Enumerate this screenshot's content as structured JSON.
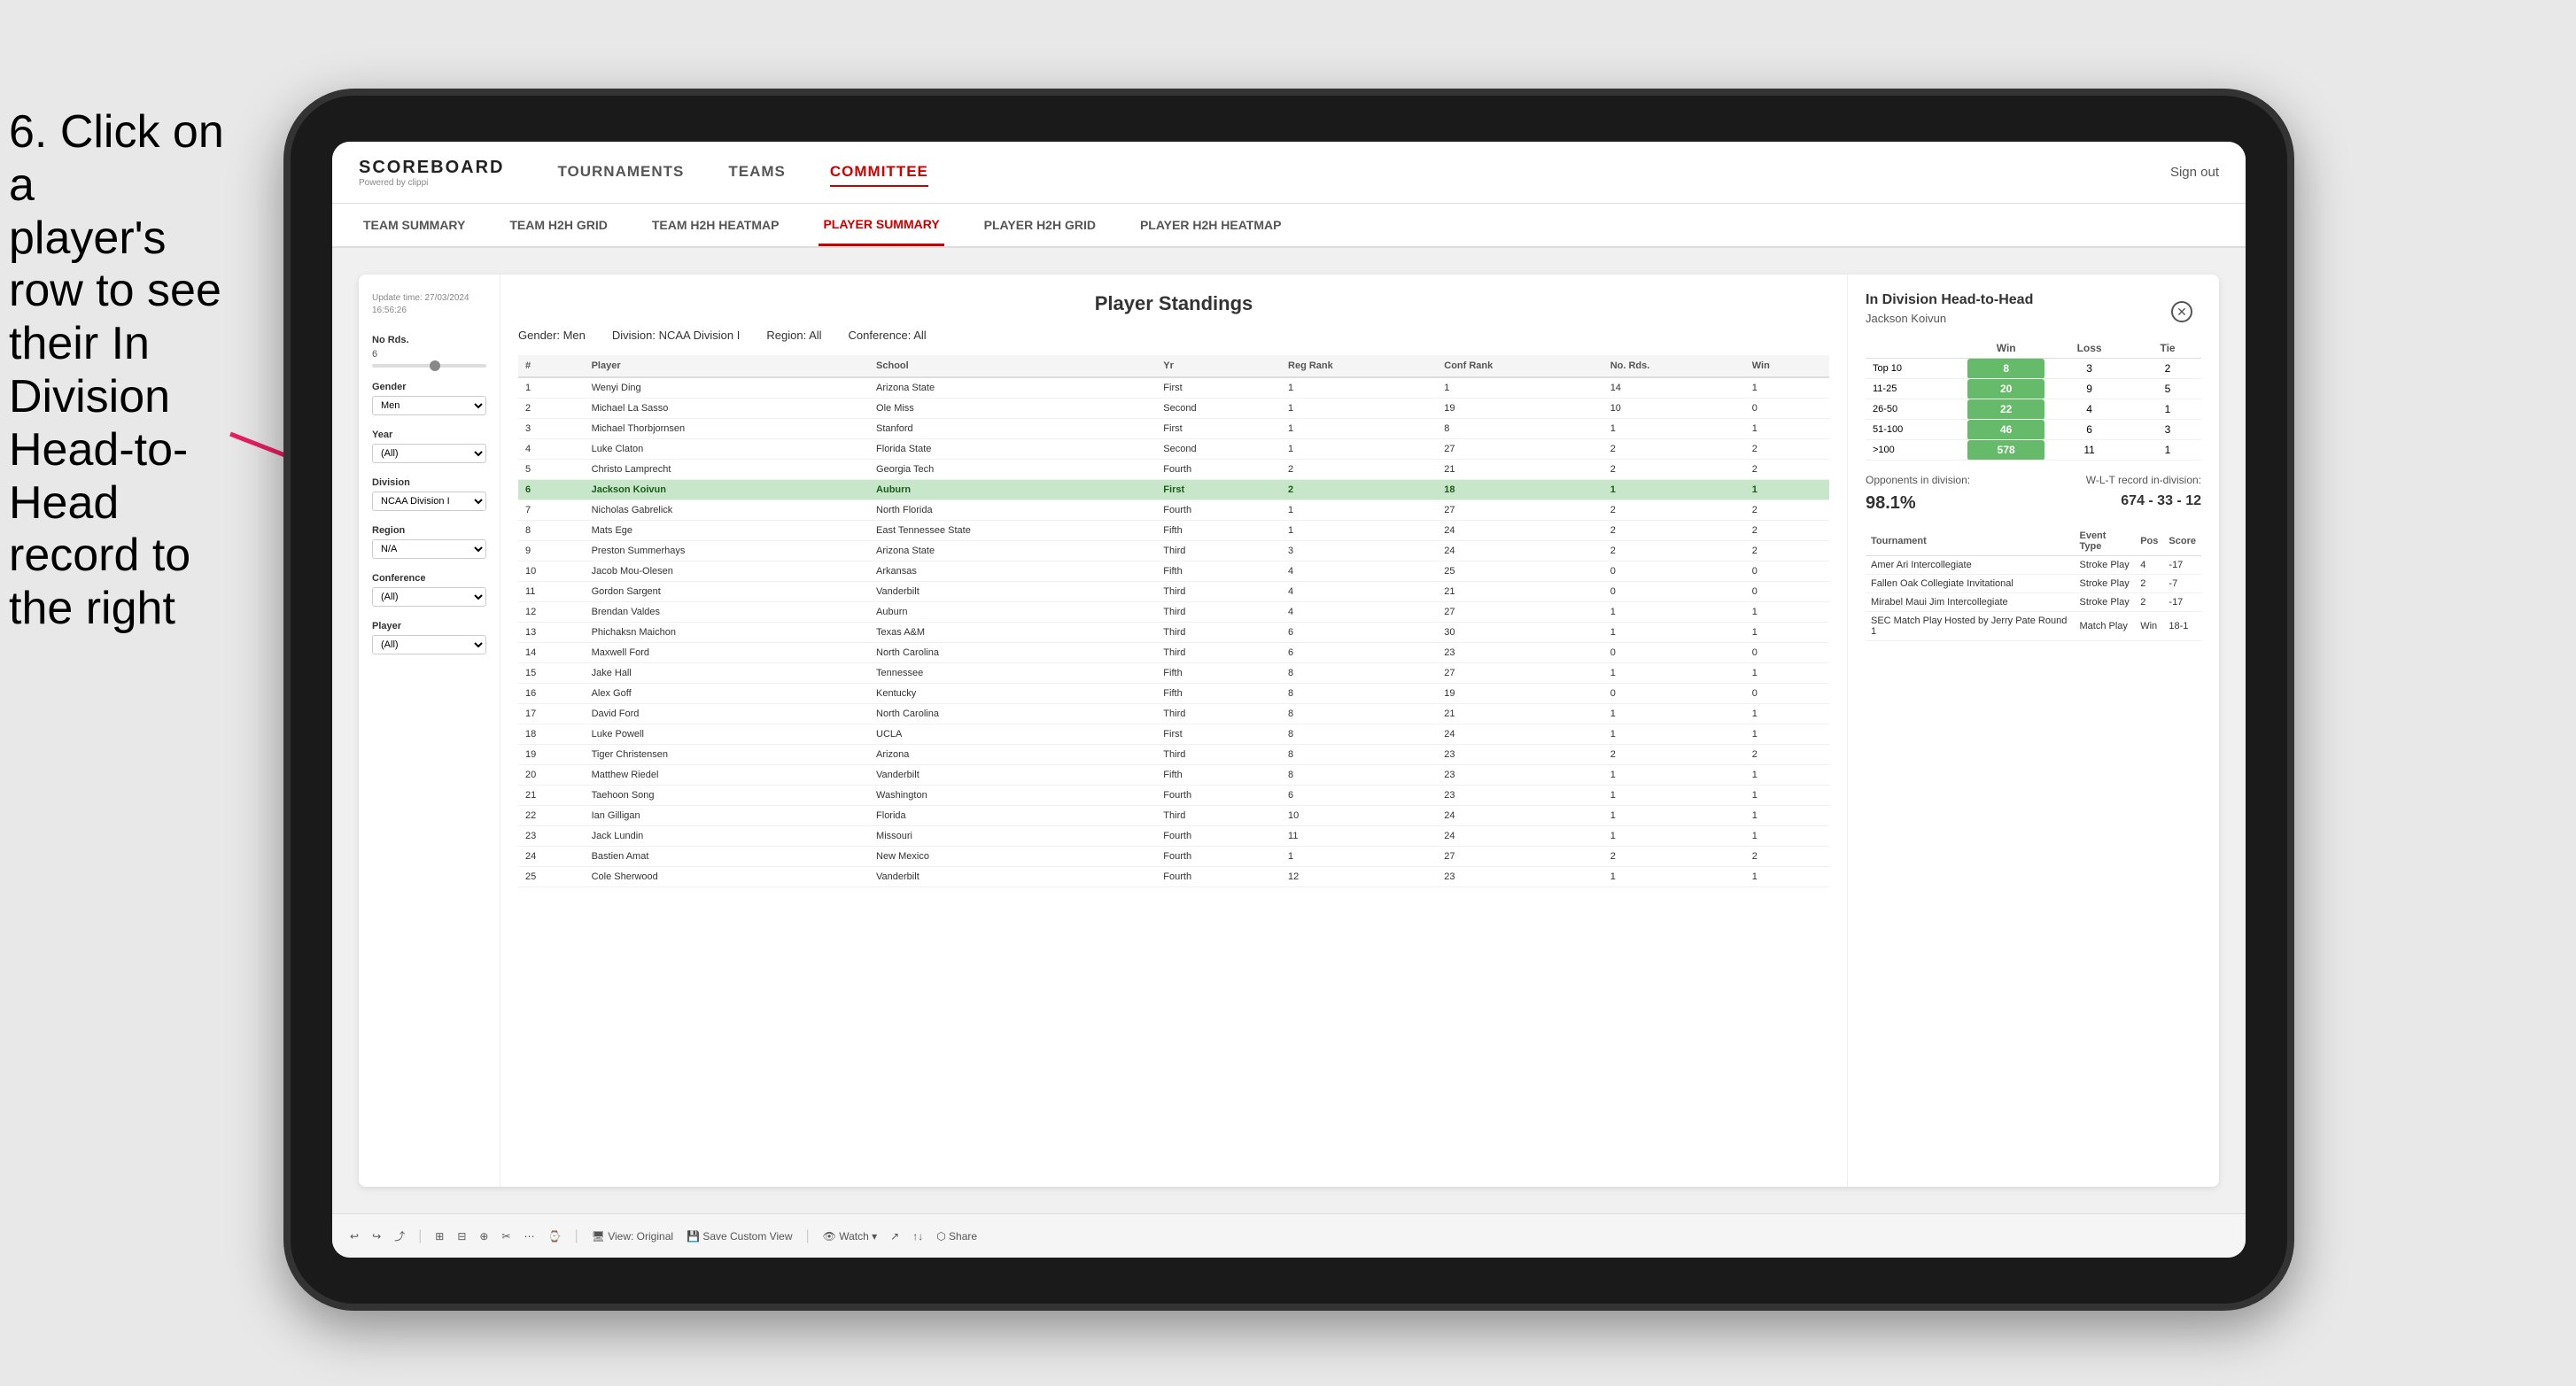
{
  "instruction": {
    "line1": "6. Click on a",
    "line2": "player's row to see",
    "line3": "their In Division",
    "line4": "Head-to-Head",
    "line5": "record to the right"
  },
  "nav": {
    "logo": "SCOREBOARD",
    "logo_sub": "Powered by clippi",
    "items": [
      "TOURNAMENTS",
      "TEAMS",
      "COMMITTEE"
    ],
    "sign_out": "Sign out"
  },
  "sub_nav": {
    "items": [
      "TEAM SUMMARY",
      "TEAM H2H GRID",
      "TEAM H2H HEATMAP",
      "PLAYER SUMMARY",
      "PLAYER H2H GRID",
      "PLAYER H2H HEATMAP"
    ]
  },
  "table": {
    "title": "Player Standings",
    "update_time": "Update time:\n27/03/2024 16:56:26",
    "filters": {
      "gender": "Gender: Men",
      "division": "Division: NCAA Division I",
      "region": "Region: All",
      "conference": "Conference: All"
    },
    "columns": [
      "#",
      "Player",
      "School",
      "Yr",
      "Reg Rank",
      "Conf Rank",
      "No. Rds.",
      "Win"
    ],
    "rows": [
      {
        "num": 1,
        "player": "Wenyi Ding",
        "school": "Arizona State",
        "yr": "First",
        "reg_rank": 1,
        "conf_rank": 1,
        "no_rds": 14,
        "win": 1
      },
      {
        "num": 2,
        "player": "Michael La Sasso",
        "school": "Ole Miss",
        "yr": "Second",
        "reg_rank": 1,
        "conf_rank": 19,
        "no_rds": 10,
        "win": 0
      },
      {
        "num": 3,
        "player": "Michael Thorbjornsen",
        "school": "Stanford",
        "yr": "First",
        "reg_rank": 1,
        "conf_rank": 8,
        "no_rds": 1,
        "win": 1
      },
      {
        "num": 4,
        "player": "Luke Claton",
        "school": "Florida State",
        "yr": "Second",
        "reg_rank": 1,
        "conf_rank": 27,
        "no_rds": 2,
        "win": 2
      },
      {
        "num": 5,
        "player": "Christo Lamprecht",
        "school": "Georgia Tech",
        "yr": "Fourth",
        "reg_rank": 2,
        "conf_rank": 21,
        "no_rds": 2,
        "win": 2
      },
      {
        "num": 6,
        "player": "Jackson Koivun",
        "school": "Auburn",
        "yr": "First",
        "reg_rank": 2,
        "conf_rank": 18,
        "no_rds": 1,
        "win": 1,
        "selected": true
      },
      {
        "num": 7,
        "player": "Nicholas Gabrelick",
        "school": "North Florida",
        "yr": "Fourth",
        "reg_rank": 1,
        "conf_rank": 27,
        "no_rds": 2,
        "win": 2
      },
      {
        "num": 8,
        "player": "Mats Ege",
        "school": "East Tennessee State",
        "yr": "Fifth",
        "reg_rank": 1,
        "conf_rank": 24,
        "no_rds": 2,
        "win": 2
      },
      {
        "num": 9,
        "player": "Preston Summerhays",
        "school": "Arizona State",
        "yr": "Third",
        "reg_rank": 3,
        "conf_rank": 24,
        "no_rds": 2,
        "win": 2
      },
      {
        "num": 10,
        "player": "Jacob Mou-Olesen",
        "school": "Arkansas",
        "yr": "Fifth",
        "reg_rank": 4,
        "conf_rank": 25,
        "no_rds": 0,
        "win": 0
      },
      {
        "num": 11,
        "player": "Gordon Sargent",
        "school": "Vanderbilt",
        "yr": "Third",
        "reg_rank": 4,
        "conf_rank": 21,
        "no_rds": 0,
        "win": 0
      },
      {
        "num": 12,
        "player": "Brendan Valdes",
        "school": "Auburn",
        "yr": "Third",
        "reg_rank": 4,
        "conf_rank": 27,
        "no_rds": 1,
        "win": 1
      },
      {
        "num": 13,
        "player": "Phichaksn Maichon",
        "school": "Texas A&M",
        "yr": "Third",
        "reg_rank": 6,
        "conf_rank": 30,
        "no_rds": 1,
        "win": 1
      },
      {
        "num": 14,
        "player": "Maxwell Ford",
        "school": "North Carolina",
        "yr": "Third",
        "reg_rank": 6,
        "conf_rank": 23,
        "no_rds": 0,
        "win": 0
      },
      {
        "num": 15,
        "player": "Jake Hall",
        "school": "Tennessee",
        "yr": "Fifth",
        "reg_rank": 8,
        "conf_rank": 27,
        "no_rds": 1,
        "win": 1
      },
      {
        "num": 16,
        "player": "Alex Goff",
        "school": "Kentucky",
        "yr": "Fifth",
        "reg_rank": 8,
        "conf_rank": 19,
        "no_rds": 0,
        "win": 0
      },
      {
        "num": 17,
        "player": "David Ford",
        "school": "North Carolina",
        "yr": "Third",
        "reg_rank": 8,
        "conf_rank": 21,
        "no_rds": 1,
        "win": 1
      },
      {
        "num": 18,
        "player": "Luke Powell",
        "school": "UCLA",
        "yr": "First",
        "reg_rank": 8,
        "conf_rank": 24,
        "no_rds": 1,
        "win": 1
      },
      {
        "num": 19,
        "player": "Tiger Christensen",
        "school": "Arizona",
        "yr": "Third",
        "reg_rank": 8,
        "conf_rank": 23,
        "no_rds": 2,
        "win": 2
      },
      {
        "num": 20,
        "player": "Matthew Riedel",
        "school": "Vanderbilt",
        "yr": "Fifth",
        "reg_rank": 8,
        "conf_rank": 23,
        "no_rds": 1,
        "win": 1
      },
      {
        "num": 21,
        "player": "Taehoon Song",
        "school": "Washington",
        "yr": "Fourth",
        "reg_rank": 6,
        "conf_rank": 23,
        "no_rds": 1,
        "win": 1
      },
      {
        "num": 22,
        "player": "Ian Gilligan",
        "school": "Florida",
        "yr": "Third",
        "reg_rank": 10,
        "conf_rank": 24,
        "no_rds": 1,
        "win": 1
      },
      {
        "num": 23,
        "player": "Jack Lundin",
        "school": "Missouri",
        "yr": "Fourth",
        "reg_rank": 11,
        "conf_rank": 24,
        "no_rds": 1,
        "win": 1
      },
      {
        "num": 24,
        "player": "Bastien Amat",
        "school": "New Mexico",
        "yr": "Fourth",
        "reg_rank": 1,
        "conf_rank": 27,
        "no_rds": 2,
        "win": 2
      },
      {
        "num": 25,
        "player": "Cole Sherwood",
        "school": "Vanderbilt",
        "yr": "Fourth",
        "reg_rank": 12,
        "conf_rank": 23,
        "no_rds": 1,
        "win": 1
      }
    ]
  },
  "sidebar": {
    "no_rds_label": "No Rds.",
    "no_rds_value": "6",
    "gender_label": "Gender",
    "gender_value": "Men",
    "year_label": "Year",
    "year_value": "(All)",
    "division_label": "Division",
    "division_value": "NCAA Division I",
    "region_label": "Region",
    "region_value": "N/A",
    "conference_label": "Conference",
    "conference_value": "(All)",
    "player_label": "Player",
    "player_value": "(All)"
  },
  "h2h": {
    "title": "In Division Head-to-Head",
    "player": "Jackson Koivun",
    "table": {
      "columns": [
        "",
        "Win",
        "Loss",
        "Tie"
      ],
      "rows": [
        {
          "range": "Top 10",
          "win": 8,
          "loss": 3,
          "tie": 2
        },
        {
          "range": "11-25",
          "win": 20,
          "loss": 9,
          "tie": 5
        },
        {
          "range": "26-50",
          "win": 22,
          "loss": 4,
          "tie": 1
        },
        {
          "range": "51-100",
          "win": 46,
          "loss": 6,
          "tie": 3
        },
        {
          "range": ">100",
          "win": 578,
          "loss": 11,
          "tie": 1
        }
      ]
    },
    "opponents_label": "Opponents in division:",
    "opponents_value": "98.1%",
    "wlt_label": "W-L-T record in-division:",
    "wlt_value": "674 - 33 - 12",
    "tournament_columns": [
      "Tournament",
      "Event Type",
      "Pos",
      "Score"
    ],
    "tournament_rows": [
      {
        "tournament": "Amer Ari Intercollegiate",
        "type": "Stroke Play",
        "pos": 4,
        "score": "-17"
      },
      {
        "tournament": "Fallen Oak Collegiate Invitational",
        "type": "Stroke Play",
        "pos": 2,
        "score": "-7"
      },
      {
        "tournament": "Mirabel Maui Jim Intercollegiate",
        "type": "Stroke Play",
        "pos": 2,
        "score": "-17"
      },
      {
        "tournament": "SEC Match Play Hosted by Jerry Pate Round 1",
        "type": "Match Play",
        "pos": "Win",
        "score": "18-1"
      }
    ]
  },
  "toolbar": {
    "items": [
      "↩",
      "↪",
      "⤴",
      "⊞",
      "⊟",
      "⊕",
      "✂",
      "⋯",
      "⌚",
      "View: Original",
      "Save Custom View",
      "Watch",
      "↗",
      "↑↓",
      "Share"
    ]
  }
}
